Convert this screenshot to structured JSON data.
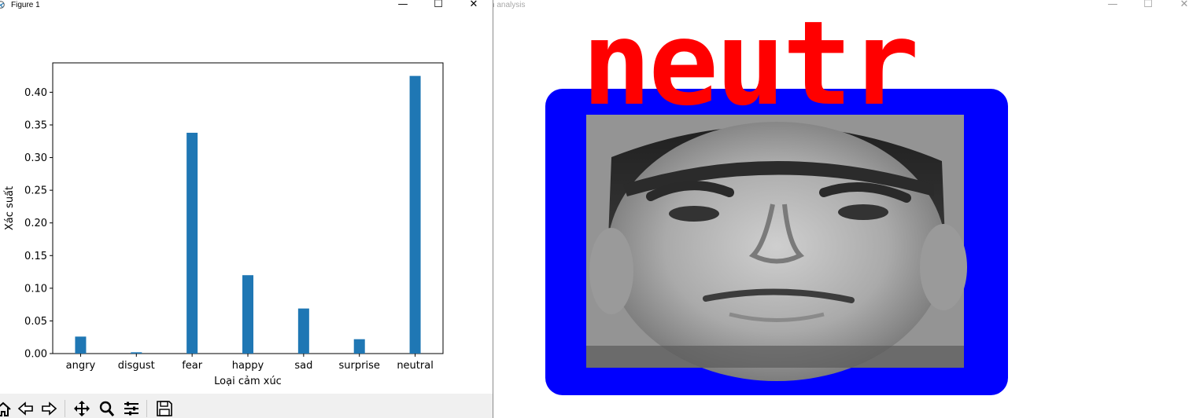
{
  "left_window": {
    "title": "Figure 1",
    "controls": {
      "minimize": "—",
      "maximize": "☐",
      "close": "✕"
    }
  },
  "right_window": {
    "title": "n analysis",
    "controls": {
      "minimize": "—",
      "maximize": "☐",
      "close": "✕"
    },
    "detected_label": "neutr",
    "label_color": "#ff0000",
    "box_color": "#0000ff"
  },
  "toolbar": {
    "buttons": [
      "home-icon",
      "back-icon",
      "forward-icon",
      "pan-icon",
      "zoom-icon",
      "configure-subplots-icon",
      "save-icon"
    ]
  },
  "chart_data": {
    "type": "bar",
    "categories": [
      "angry",
      "disgust",
      "fear",
      "happy",
      "sad",
      "surprise",
      "neutral"
    ],
    "values": [
      0.026,
      0.002,
      0.338,
      0.12,
      0.069,
      0.022,
      0.425
    ],
    "xlabel": "Loại cảm xúc",
    "ylabel": "Xác suất",
    "yticks": [
      "0.00",
      "0.05",
      "0.10",
      "0.15",
      "0.20",
      "0.25",
      "0.30",
      "0.35",
      "0.40"
    ],
    "ylim": [
      0,
      0.445
    ],
    "bar_color": "#1f77b4",
    "grid": false
  }
}
